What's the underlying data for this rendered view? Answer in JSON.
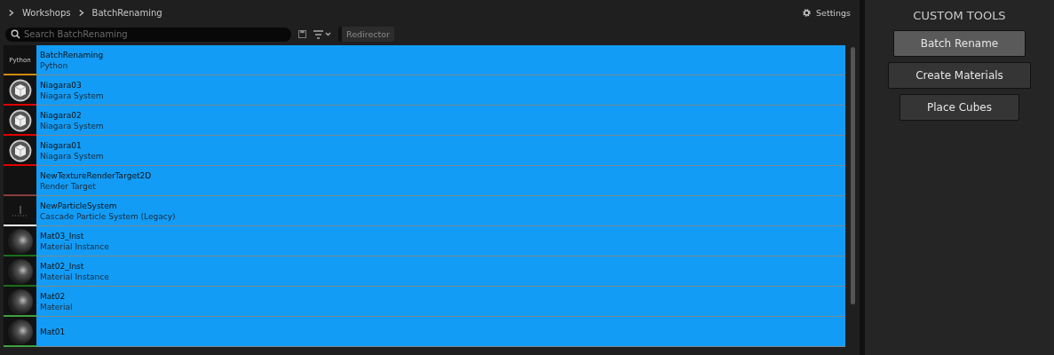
{
  "breadcrumb": [
    "Workshops",
    "BatchRenaming"
  ],
  "settings": {
    "label": "Settings"
  },
  "search": {
    "placeholder": "Search BatchRenaming"
  },
  "filter_chip": {
    "label": "Redirector",
    "on": false
  },
  "assets": [
    {
      "name": "BatchRenaming",
      "type": "Python",
      "kind": "label",
      "thumb_text": "Python",
      "color": "#d08a10",
      "selected": true
    },
    {
      "name": "Niagara03",
      "type": "Niagara System",
      "kind": "niagara",
      "color": "#e00000",
      "selected": true
    },
    {
      "name": "Niagara02",
      "type": "Niagara System",
      "kind": "niagara",
      "color": "#e00000",
      "selected": true
    },
    {
      "name": "Niagara01",
      "type": "Niagara System",
      "kind": "niagara",
      "color": "#e00000",
      "selected": true
    },
    {
      "name": "NewTextureRenderTarget2D",
      "type": "Render Target",
      "kind": "black",
      "color": "#8a3c3c",
      "selected": true
    },
    {
      "name": "NewParticleSystem",
      "type": "Cascade Particle System (Legacy)",
      "kind": "particle",
      "color": "#ffffff",
      "selected": true
    },
    {
      "name": "Mat03_Inst",
      "type": "Material Instance",
      "kind": "sphere",
      "color": "#1a6e1a",
      "selected": true
    },
    {
      "name": "Mat02_Inst",
      "type": "Material Instance",
      "kind": "sphere",
      "color": "#1a6e1a",
      "selected": true
    },
    {
      "name": "Mat02",
      "type": "Material",
      "kind": "sphere",
      "color": "#3fa03f",
      "selected": true
    },
    {
      "name": "Mat01",
      "kind": "sphere",
      "color": "#3fa03f",
      "selected": true
    }
  ],
  "tools_panel": {
    "title": "CUSTOM TOOLS",
    "buttons": [
      {
        "label": "Batch Rename",
        "hovered": true
      },
      {
        "label": "Create Materials",
        "hovered": false
      },
      {
        "label": "Place Cubes",
        "hovered": false
      }
    ]
  }
}
